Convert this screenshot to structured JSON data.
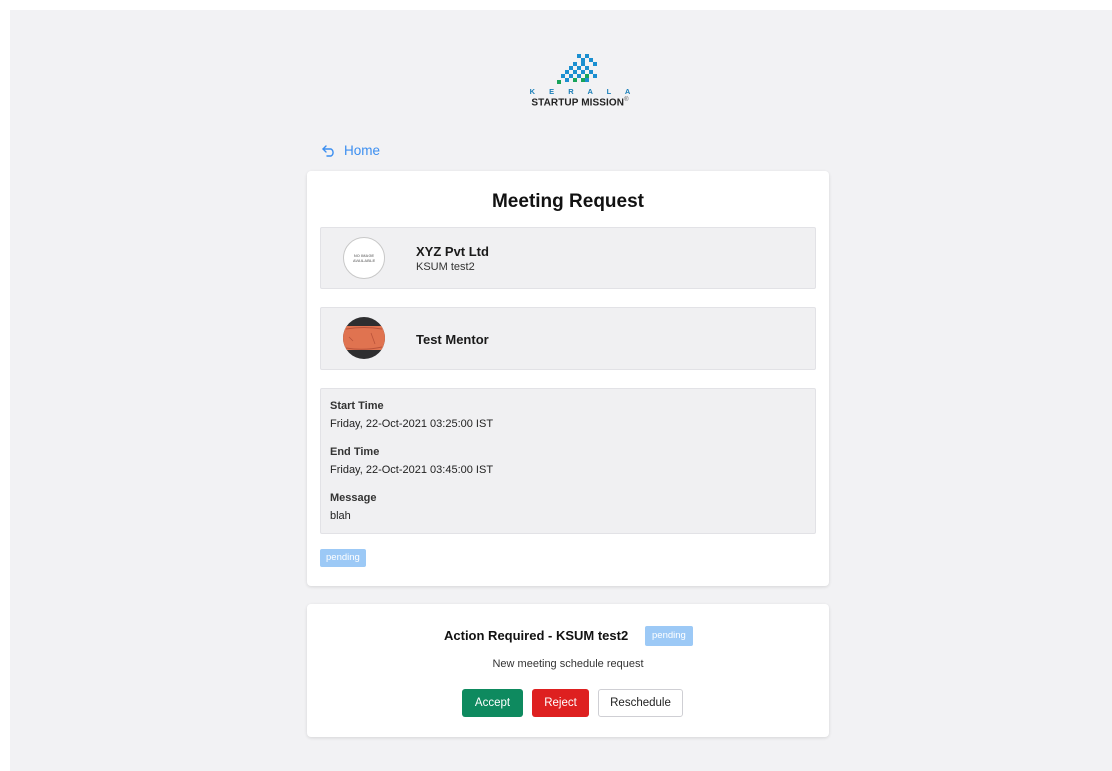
{
  "brand": {
    "line1": "K E R A L A",
    "line2": "STARTUP MISSION",
    "mark": "®",
    "logo_icon": "checkered-flag-logo",
    "accent": "#1b7fb8"
  },
  "nav": {
    "home_label": "Home",
    "home_icon": "back-arrow-icon"
  },
  "meeting": {
    "title": "Meeting Request",
    "company": {
      "avatar_text": "NO IMAGE AVAILABLE",
      "name": "XYZ Pvt Ltd",
      "subtitle": "KSUM test2"
    },
    "mentor": {
      "name": "Test Mentor"
    },
    "details": {
      "start_label": "Start Time",
      "start_value": "Friday, 22-Oct-2021 03:25:00 IST",
      "end_label": "End Time",
      "end_value": "Friday, 22-Oct-2021 03:45:00 IST",
      "message_label": "Message",
      "message_value": "blah"
    },
    "status": "pending"
  },
  "action": {
    "title": "Action Required - KSUM test2",
    "status": "pending",
    "subtitle": "New meeting schedule request",
    "accept_label": "Accept",
    "reject_label": "Reject",
    "reschedule_label": "Reschedule"
  },
  "colors": {
    "link": "#3b8ef0",
    "accept": "#0e8a5f",
    "reject": "#de2020",
    "pending_badge": "#9cc9f6"
  }
}
